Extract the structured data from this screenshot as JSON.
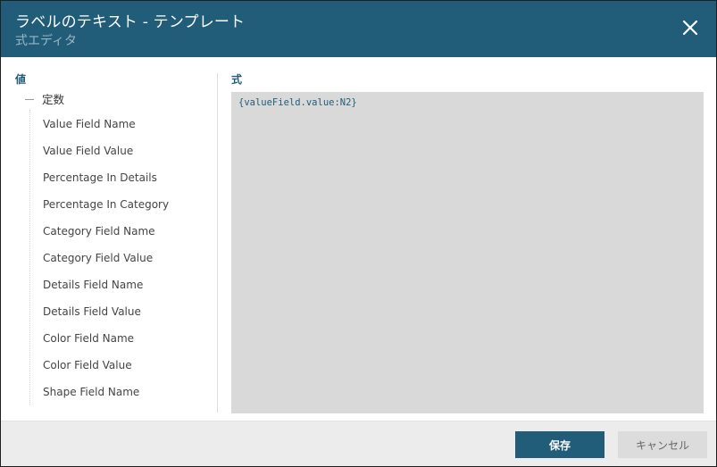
{
  "header": {
    "title": "ラベルのテキスト - テンプレート",
    "subtitle": "式エディタ",
    "close_icon": "close-icon"
  },
  "left": {
    "heading": "値",
    "tree": {
      "root_label": "定数",
      "items": [
        "Value Field Name",
        "Value Field Value",
        "Percentage In Details",
        "Percentage In Category",
        "Category Field Name",
        "Category Field Value",
        "Details Field Name",
        "Details Field Value",
        "Color Field Name",
        "Color Field Value",
        "Shape Field Name"
      ]
    }
  },
  "right": {
    "heading": "式",
    "expression": "{valueField.value:N2}"
  },
  "footer": {
    "save_label": "保存",
    "cancel_label": "キャンセル"
  },
  "colors": {
    "header_bg": "#215d79",
    "accent": "#215d79",
    "editor_bg": "#d9d9d9"
  }
}
